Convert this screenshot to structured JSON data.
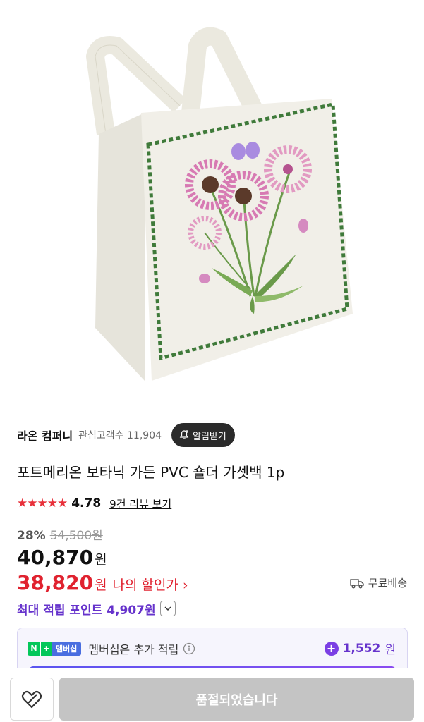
{
  "seller": {
    "name": "라온 컴퍼니",
    "meta": "관심고객수 11,904",
    "notify_label": "알림받기"
  },
  "product": {
    "title": "포트메리온 보타닉 가든 PVC 숄더 가셋백 1p",
    "image_icon": "tote-bag-botanic-image"
  },
  "rating": {
    "stars": "★★★★★",
    "value": "4.78",
    "review_link": "9건 리뷰 보기"
  },
  "price": {
    "discount_rate": "28%",
    "original": "54,500원",
    "current": "40,870",
    "current_unit": "원",
    "my_price": "38,820",
    "my_price_unit": "원",
    "my_price_label": "나의 할인가",
    "my_price_arrow": "›"
  },
  "shipping": {
    "label": "무료배송",
    "icon": "truck-icon"
  },
  "points": {
    "label": "최대 적립 포인트 4,907원"
  },
  "membership": {
    "badge_n": "N",
    "badge_plus": "+",
    "badge_text": "멤버십",
    "label": "멤버십은 추가 적립",
    "bonus_sign": "+",
    "bonus_value": "1,552",
    "bonus_unit": "원"
  },
  "bottom": {
    "wish_icon": "heart-off-icon",
    "soldout_label": "품절되었습니다"
  },
  "colors": {
    "accent_red": "#e0222f",
    "points_purple": "#6633cc",
    "disabled_gray": "#c4c4c4"
  }
}
